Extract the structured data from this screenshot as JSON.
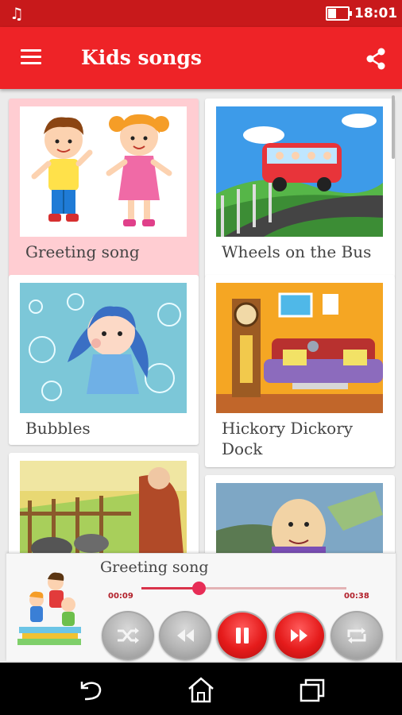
{
  "status_bar": {
    "time": "18:01",
    "icons": [
      "music-note-icon",
      "battery-icon"
    ],
    "battery_level": 0.3
  },
  "app_bar": {
    "title": "Kids songs",
    "icons": [
      "menu-icon",
      "share-icon"
    ]
  },
  "songs": [
    {
      "title": "Greeting song",
      "selected": true
    },
    {
      "title": "Wheels on the Bus",
      "selected": false
    },
    {
      "title": "Bubbles",
      "selected": false
    },
    {
      "title": "Hickory Dickory Dock",
      "selected": false
    },
    {
      "title": "",
      "selected": false
    },
    {
      "title": "",
      "selected": false
    }
  ],
  "player": {
    "now_playing": "Greeting song",
    "elapsed": "00:09",
    "total": "00:38",
    "progress": 0.28,
    "controls": [
      "shuffle-icon",
      "rewind-icon",
      "pause-icon",
      "fast-forward-icon",
      "repeat-icon"
    ]
  },
  "nav_bar": {
    "icons": [
      "back-icon",
      "home-icon",
      "recent-apps-icon"
    ]
  },
  "colors": {
    "status_bar": "#c8191b",
    "app_bar": "#ee2327",
    "selected_card": "#ffcdd2",
    "seek_accent": "#e72d56"
  }
}
